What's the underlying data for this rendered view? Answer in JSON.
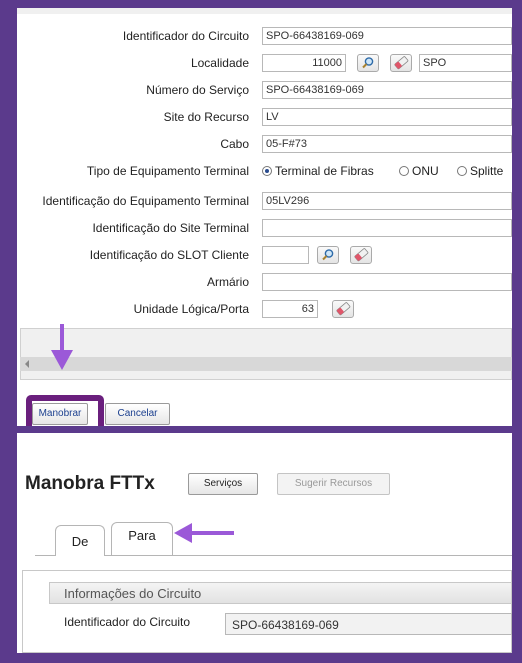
{
  "form": {
    "rows": [
      {
        "label": "Identificador do Circuito",
        "value": "SPO-66438169-069"
      },
      {
        "label": "Localidade",
        "value": "11000",
        "value2": "SPO"
      },
      {
        "label": "Número do Serviço",
        "value": "SPO-66438169-069"
      },
      {
        "label": "Site do Recurso",
        "value": "LV"
      },
      {
        "label": "Cabo",
        "value": "05-F#73"
      },
      {
        "label": "Tipo de Equipamento Terminal"
      },
      {
        "label": "Identificação do Equipamento Terminal",
        "value": "05LV296"
      },
      {
        "label": "Identificação do Site Terminal",
        "value": ""
      },
      {
        "label": "Identificação do SLOT Cliente",
        "value": ""
      },
      {
        "label": "Armário",
        "value": ""
      },
      {
        "label": "Unidade Lógica/Porta",
        "value": "63"
      }
    ],
    "radio_options": [
      {
        "label": "Terminal de Fibras",
        "selected": true
      },
      {
        "label": "ONU",
        "selected": false
      },
      {
        "label": "Splitte",
        "selected": false
      }
    ],
    "buttons": {
      "manobrar": "Manobrar",
      "cancelar": "Cancelar"
    }
  },
  "manobra": {
    "title": "Manobra FTTx",
    "servicos_label": "Serviços",
    "sugerir_label": "Sugerir Recursos",
    "tabs": [
      {
        "label": "De",
        "active": true
      },
      {
        "label": "Para",
        "active": false
      }
    ],
    "section_title": "Informações do Circuito",
    "circuit_label": "Identificador do Circuito",
    "circuit_value": "SPO-66438169-069"
  },
  "colors": {
    "annotation": "#9b59d8",
    "highlight_box": "#6a1f7d",
    "frame": "#5b3a8c"
  }
}
